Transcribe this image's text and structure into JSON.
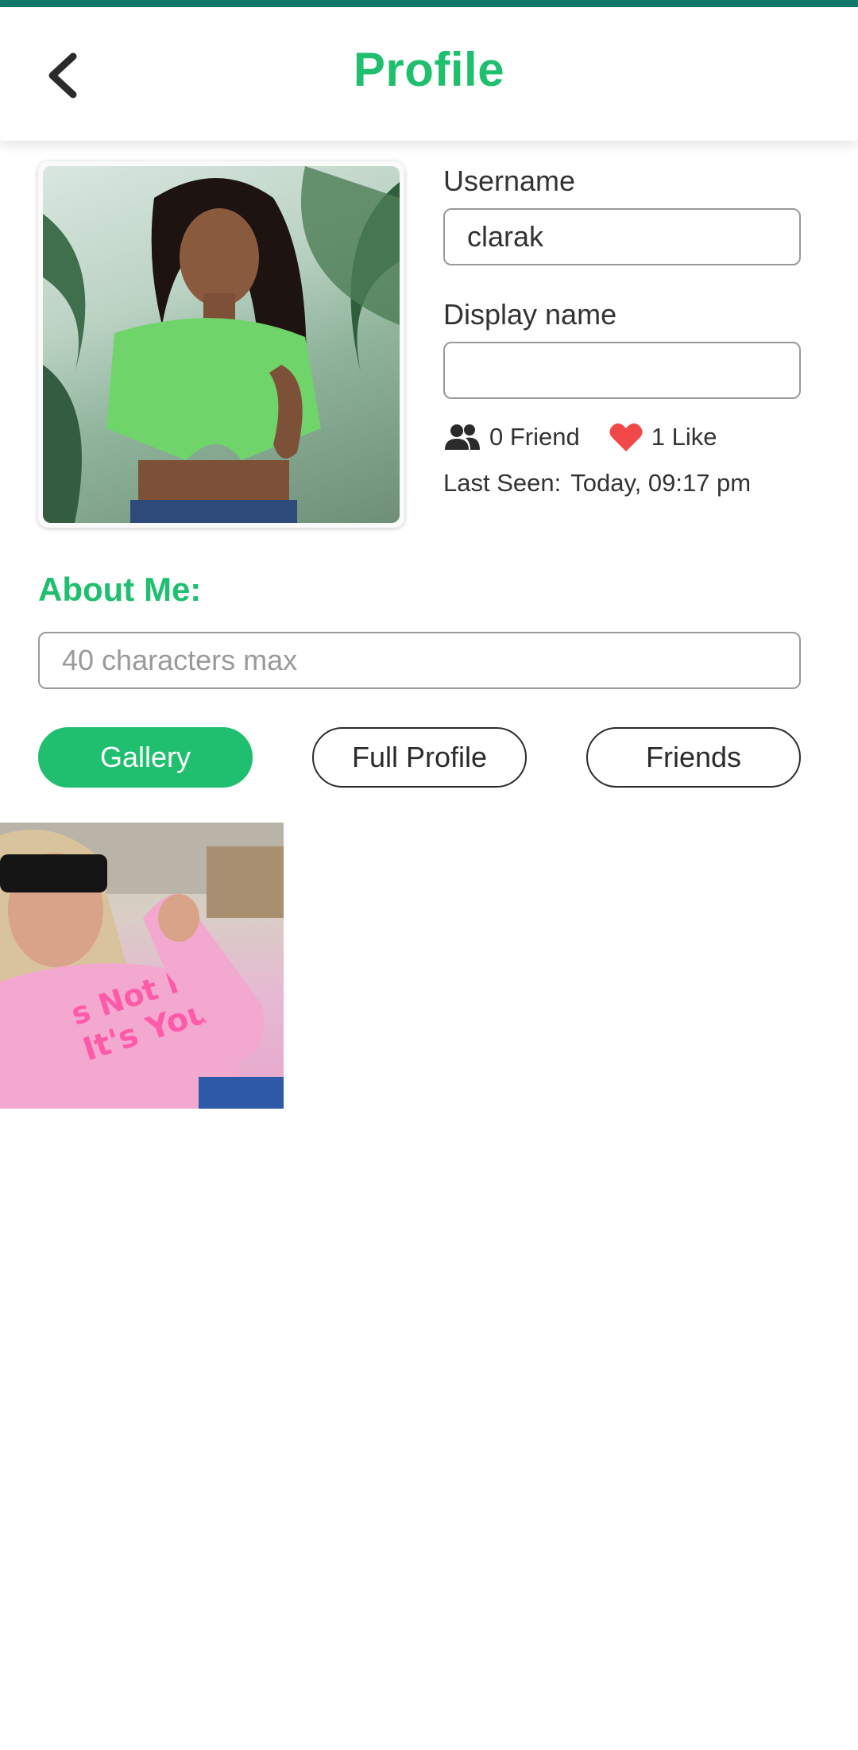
{
  "header": {
    "title": "Profile",
    "back_icon": "chevron-left-icon"
  },
  "profile": {
    "username_label": "Username",
    "username_value": "clarak",
    "display_name_label": "Display name",
    "display_name_value": "",
    "friends_text": "0 Friend",
    "likes_text": "1 Like",
    "last_seen_label": "Last Seen:",
    "last_seen_value": "Today, 09:17 pm"
  },
  "about": {
    "title": "About Me:",
    "placeholder": "40 characters max"
  },
  "tabs": [
    {
      "label": "Gallery",
      "active": true
    },
    {
      "label": "Full Profile",
      "active": false
    },
    {
      "label": "Friends",
      "active": false
    }
  ],
  "colors": {
    "accent": "#1fbf6f",
    "top_bar": "#137a6b",
    "heart": "#f04848"
  }
}
